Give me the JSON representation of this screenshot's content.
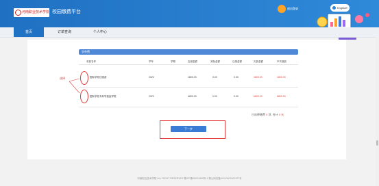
{
  "header": {
    "logo_text": "河南职业技术学院财务处",
    "platform_title": "校园缴费平台",
    "user_label": "退出登录",
    "language": "English"
  },
  "nav": {
    "items": [
      {
        "label": "首页",
        "active": true
      },
      {
        "label": "订单查询",
        "active": false
      },
      {
        "label": "个人中心",
        "active": false
      }
    ]
  },
  "fee_section": {
    "title": "学杂费",
    "columns": [
      "收费名称",
      "学年",
      "学期",
      "应缴金额",
      "减免金额",
      "已缴金额",
      "欠费金额",
      "本次缴费"
    ],
    "rows": [
      {
        "name": "国际学校住宿费",
        "year": "2022",
        "term": "",
        "due": "1800.00",
        "waived": "0.00",
        "paid": "0.00",
        "owed": "1800.00",
        "this_payment": "1800.00"
      },
      {
        "name": "国际学校专科学费医学类",
        "year": "2022",
        "term": "",
        "due": "6800.00",
        "waived": "0.00",
        "paid": "0.00",
        "owed": "6800.00",
        "this_payment": "6800.00"
      }
    ]
  },
  "annotation": {
    "select_label": "选择"
  },
  "summary": {
    "selected_prefix": "已选择缴费",
    "selected_count": "0",
    "selected_unit": "项,",
    "total_prefix": "合计",
    "total_amount": "0",
    "currency": "元"
  },
  "actions": {
    "next_label": "下一步"
  },
  "footer": {
    "text": "河南职业技术学院 ALL RIGHT RESERVED   豫ICP备05001869号-1  豫公网安备41010402000127号"
  },
  "colors": {
    "header_blue": "#1f70c2",
    "section_blue": "#4e88d6",
    "annotation_red": "#e23b3b",
    "amount_red": "#e0433d",
    "user_orange": "#ffa424"
  },
  "icons": {
    "user": "user-avatar-icon",
    "language": "globe-icon",
    "caret": "chevron-down-icon",
    "illustration": "finance-illustration"
  }
}
